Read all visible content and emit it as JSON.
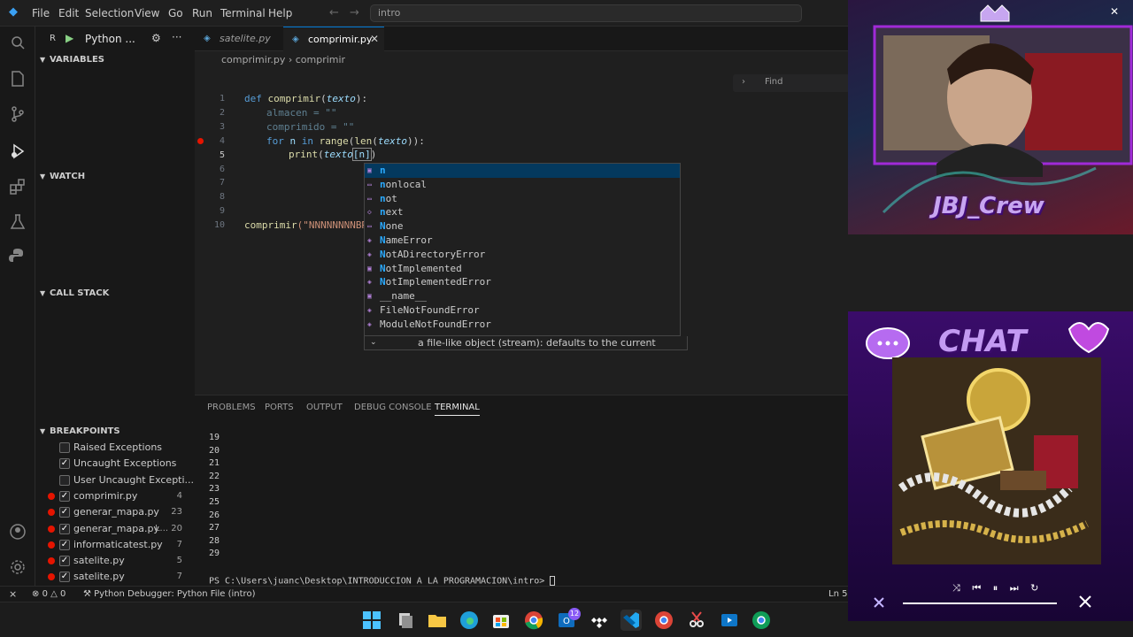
{
  "menu": [
    "File",
    "Edit",
    "Selection",
    "View",
    "Go",
    "Run",
    "Terminal",
    "Help"
  ],
  "command_center": "intro",
  "run_config": {
    "prefix": "R",
    "label": "Python ..."
  },
  "tabs": [
    {
      "label": "satelite.py",
      "active": false
    },
    {
      "label": "comprimir.py",
      "active": true
    }
  ],
  "breadcrumb": {
    "file": "comprimir.py",
    "symbol": "comprimir"
  },
  "sidebar": {
    "variables": "VARIABLES",
    "watch": "WATCH",
    "call_stack": "CALL STACK",
    "breakpoints": "BREAKPOINTS",
    "breakpoint_items": [
      {
        "label": "Raised Exceptions",
        "checked": false,
        "dot": false,
        "count": ""
      },
      {
        "label": "Uncaught Exceptions",
        "checked": true,
        "dot": false,
        "count": ""
      },
      {
        "label": "User Uncaught Excepti...",
        "checked": false,
        "dot": false,
        "count": ""
      },
      {
        "label": "comprimir.py",
        "checked": true,
        "dot": true,
        "count": "4"
      },
      {
        "label": "generar_mapa.py",
        "checked": true,
        "dot": true,
        "count": "23"
      },
      {
        "label": "generar_mapa.py",
        "checked": true,
        "dot": true,
        "count": "L... 20"
      },
      {
        "label": "informaticatest.py",
        "checked": true,
        "dot": true,
        "count": "7"
      },
      {
        "label": "satelite.py",
        "checked": true,
        "dot": true,
        "count": "5"
      },
      {
        "label": "satelite.py",
        "checked": true,
        "dot": true,
        "count": "7"
      }
    ]
  },
  "editor": {
    "line_numbers": [
      "1",
      "2",
      "3",
      "4",
      "5",
      "6",
      "7",
      "8",
      "9",
      "10"
    ],
    "line1": {
      "def": "def",
      "fn": "comprimir",
      "open": "(",
      "param": "texto",
      "close": "):"
    },
    "line2": "almacen = \"\"",
    "line3": "comprimido = \"\"",
    "line4": {
      "for": "for",
      "n": "n",
      "in": "in",
      "range": "range",
      "len": "len",
      "texto": "texto",
      "tail": "))):"
    },
    "line5": {
      "print": "print",
      "texto": "texto",
      "idx": "[n]",
      "close": ")"
    },
    "line10": {
      "fn": "comprimir",
      "arg": "(\"NNNNNNNNBR"
    }
  },
  "find_placeholder": "Find",
  "suggestions": [
    {
      "match": "n",
      "rest": "",
      "icon": "variable-icon"
    },
    {
      "match": "n",
      "rest": "onlocal",
      "icon": "keyword-icon"
    },
    {
      "match": "n",
      "rest": "ot",
      "icon": "keyword-icon"
    },
    {
      "match": "n",
      "rest": "ext",
      "icon": "function-icon"
    },
    {
      "match": "N",
      "rest": "one",
      "icon": "keyword-icon"
    },
    {
      "match": "N",
      "rest": "ameError",
      "icon": "class-icon"
    },
    {
      "match": "N",
      "rest": "otADirectoryError",
      "icon": "class-icon"
    },
    {
      "match": "N",
      "rest": "otImplemented",
      "icon": "variable-icon"
    },
    {
      "match": "N",
      "rest": "otImplementedError",
      "icon": "class-icon"
    },
    {
      "match": "",
      "rest": "__name__",
      "icon": "variable-icon"
    },
    {
      "match": "",
      "rest": "FileNotFoundError",
      "icon": "class-icon"
    },
    {
      "match": "",
      "rest": "ModuleNotFoundError",
      "icon": "class-icon"
    }
  ],
  "suggest_doc": "a file-like object (stream): defaults to the current",
  "panel_tabs": [
    "PROBLEMS",
    "PORTS",
    "OUTPUT",
    "DEBUG CONSOLE",
    "TERMINAL"
  ],
  "terminal_lines": [
    "19",
    "20",
    "21",
    "22",
    "23",
    "25",
    "26",
    "27",
    "28",
    "29"
  ],
  "terminal_prompt": "PS C:\\Users\\juanc\\Desktop\\INTRODUCCION A LA PROGRAMACION\\intro> ",
  "status": {
    "errors": "0",
    "warnings": "0",
    "debugger": "Python Debugger: Python File (intro)",
    "position": "Ln 5,"
  },
  "overlay": {
    "crew": "JBJ_Crew",
    "chat": "CHAT"
  },
  "taskbar_badge": "12",
  "colors": {
    "accent": "#0078d4",
    "breakpoint": "#e51400",
    "purple": "#8a2be2"
  }
}
